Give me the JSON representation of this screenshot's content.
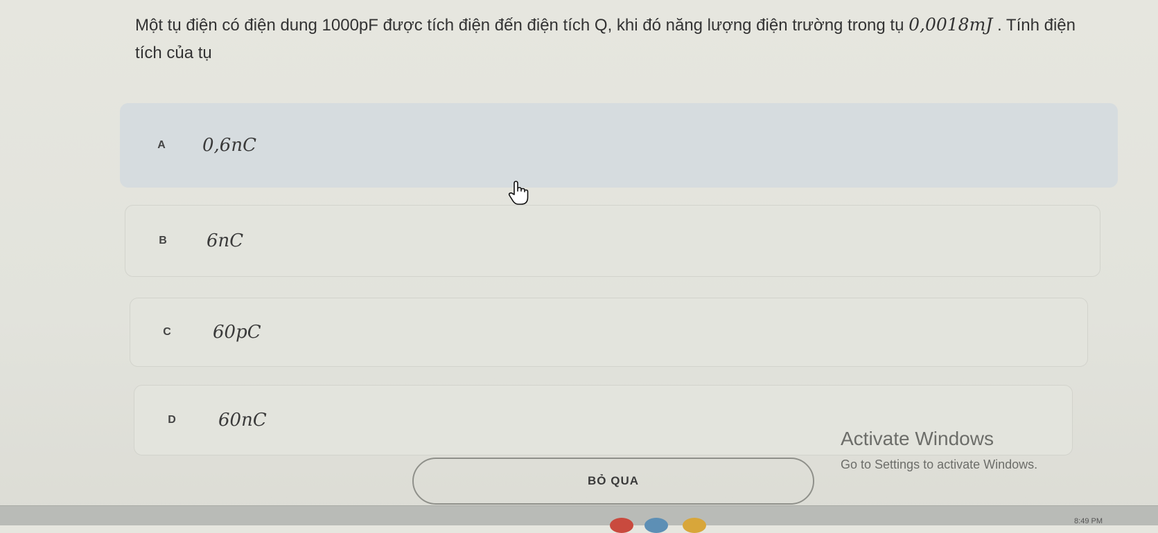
{
  "question": {
    "text_prefix": "Một tụ điện có điện dung 1000pF được tích điện đến điện tích Q, khi đó năng lượng điện trường trong tụ",
    "math": "0,0018mJ",
    "text_suffix": ". Tính điện tích của tụ"
  },
  "options": [
    {
      "letter": "A",
      "value": "0,6nC",
      "selected": true
    },
    {
      "letter": "B",
      "value": "6nC",
      "selected": false
    },
    {
      "letter": "C",
      "value": "60pC",
      "selected": false
    },
    {
      "letter": "D",
      "value": "60nC",
      "selected": false
    }
  ],
  "skip_button": {
    "label": "BỎ QUA"
  },
  "watermark": {
    "title": "Activate Windows",
    "subtitle": "Go to Settings to activate Windows."
  },
  "taskbar": {
    "clock": "8:49 PM"
  },
  "colors": {
    "background": "#e3e4dd",
    "selected_option": "#d6dcdf",
    "option_border": "#d2d3cc",
    "button_border": "#8f908a"
  },
  "icons": {
    "cursor": "hand-pointer-icon"
  }
}
